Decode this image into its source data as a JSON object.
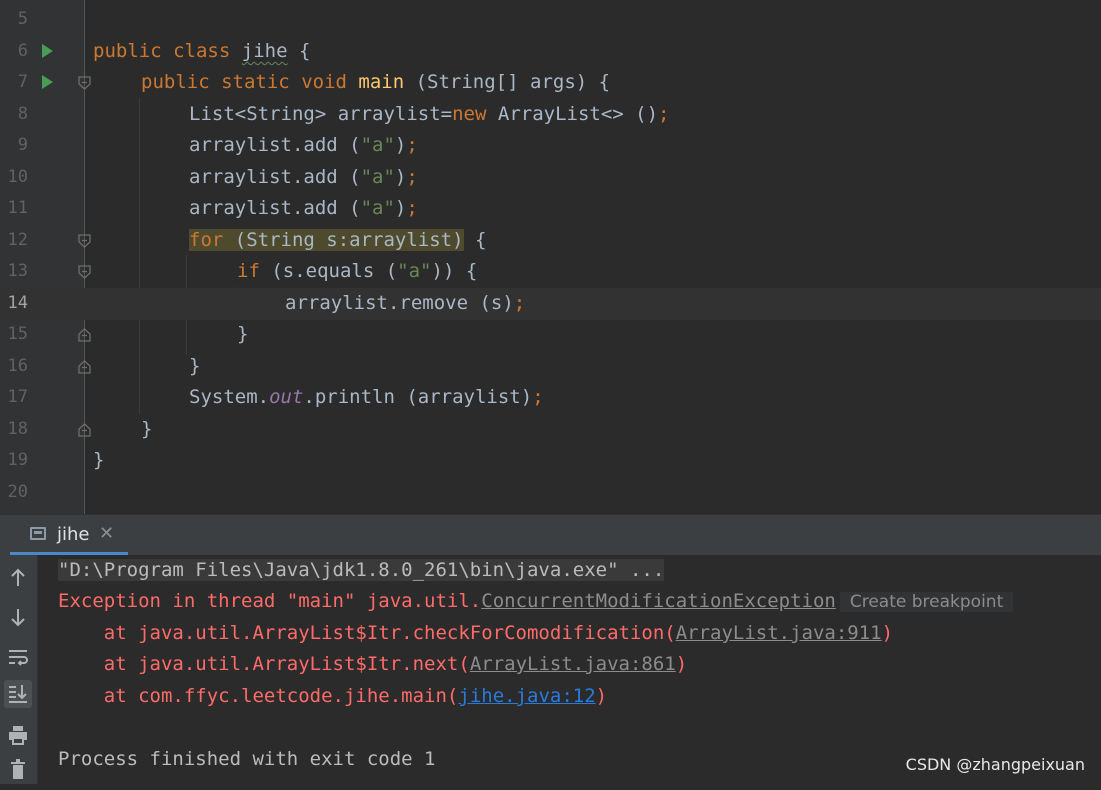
{
  "editor": {
    "line_numbers": [
      "5",
      "6",
      "7",
      "8",
      "9",
      "10",
      "11",
      "12",
      "13",
      "14",
      "15",
      "16",
      "17",
      "18",
      "19",
      "20"
    ],
    "tokens": {
      "public": "public",
      "class": "class",
      "static": "static",
      "void": "void",
      "class_name": "jihe",
      "brace_open": " {",
      "main": "main",
      "main_params": " (String[] args) {",
      "l8_a": "List<String> arraylist=",
      "new": "new",
      "l8_b": " ArrayList<> ()",
      "semi": ";",
      "add_call": "arraylist.add (",
      "str_a": "\"a\"",
      "close_paren": ")",
      "for": "for",
      "for_body": " (String s:arraylist)",
      "for_brace": " {",
      "if": "if",
      "if_a": " (s.equals (",
      "if_b": ")) {",
      "remove_call": "arraylist.remove (s)",
      "brace_close": "}",
      "system": "System.",
      "out": "out",
      "println": ".println (arraylist)"
    }
  },
  "console": {
    "tab_label": "jihe",
    "tab_close": "✕",
    "toolbar_icons": [
      "arrow-up-icon",
      "arrow-down-icon",
      "soft-wrap-icon",
      "scroll-to-end-icon",
      "print-icon",
      "trash-icon"
    ],
    "cmd_line": "\"D:\\Program Files\\Java\\jdk1.8.0_261\\bin\\java.exe\" ...",
    "exc_prefix": "Exception in thread \"main\" java.util.",
    "exc_class": "ConcurrentModificationException",
    "create_breakpoint": "Create breakpoint",
    "st1_prefix": "    at java.util.ArrayList$Itr.checkForComodification(",
    "st1_link": "ArrayList.java:911",
    "st2_prefix": "    at java.util.ArrayList$Itr.next(",
    "st2_link": "ArrayList.java:861",
    "st3_prefix": "    at com.ffyc.leetcode.jihe.main(",
    "st3_link": "jihe.java:12",
    "paren_close": ")",
    "finish": "Process finished with exit code 1"
  },
  "watermark": "CSDN @zhangpeixuan",
  "colors": {
    "keyword": "#cc7832",
    "string": "#6a8759",
    "method": "#ffc66d",
    "error": "#ff6b68",
    "link": "#287bde"
  }
}
